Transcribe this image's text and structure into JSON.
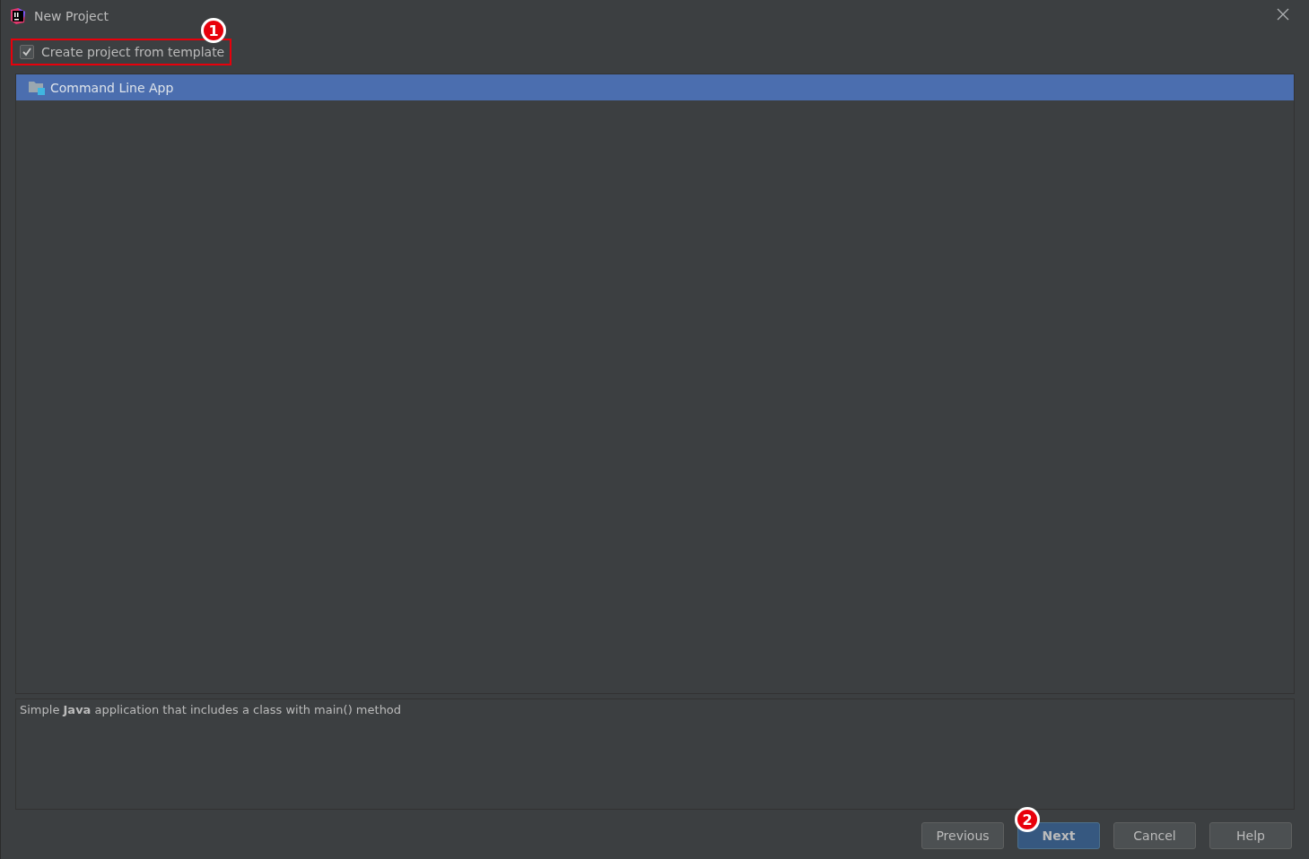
{
  "window": {
    "title": "New Project"
  },
  "template_checkbox": {
    "label": "Create project from template",
    "checked": true,
    "highlighted": true,
    "callout": "1"
  },
  "templates": [
    {
      "label": "Command Line App",
      "selected": true
    }
  ],
  "description": "Simple **Java** application that includes a class with main() method",
  "buttons": [
    {
      "label": "Previous",
      "default": false
    },
    {
      "label": "Next",
      "default": true,
      "callout": "2"
    },
    {
      "label": "Cancel",
      "default": false
    },
    {
      "label": "Help",
      "default": false
    }
  ]
}
